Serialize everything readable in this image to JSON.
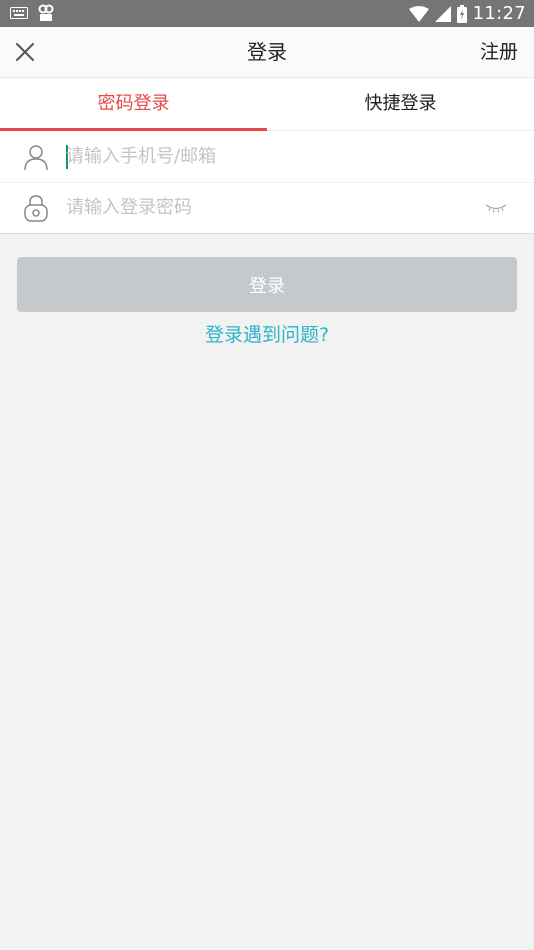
{
  "status_bar": {
    "time": "11:27"
  },
  "header": {
    "title": "登录",
    "register_label": "注册"
  },
  "tabs": [
    {
      "label": "密码登录",
      "active": true
    },
    {
      "label": "快捷登录",
      "active": false
    }
  ],
  "form": {
    "account_placeholder": "请输入手机号/邮箱",
    "account_value": "",
    "password_placeholder": "请输入登录密码",
    "password_value": ""
  },
  "actions": {
    "login_label": "登录",
    "help_label": "登录遇到问题?"
  },
  "colors": {
    "accent": "#e8474a",
    "link": "#2cb5c8",
    "button_disabled": "#c5c9cc"
  }
}
